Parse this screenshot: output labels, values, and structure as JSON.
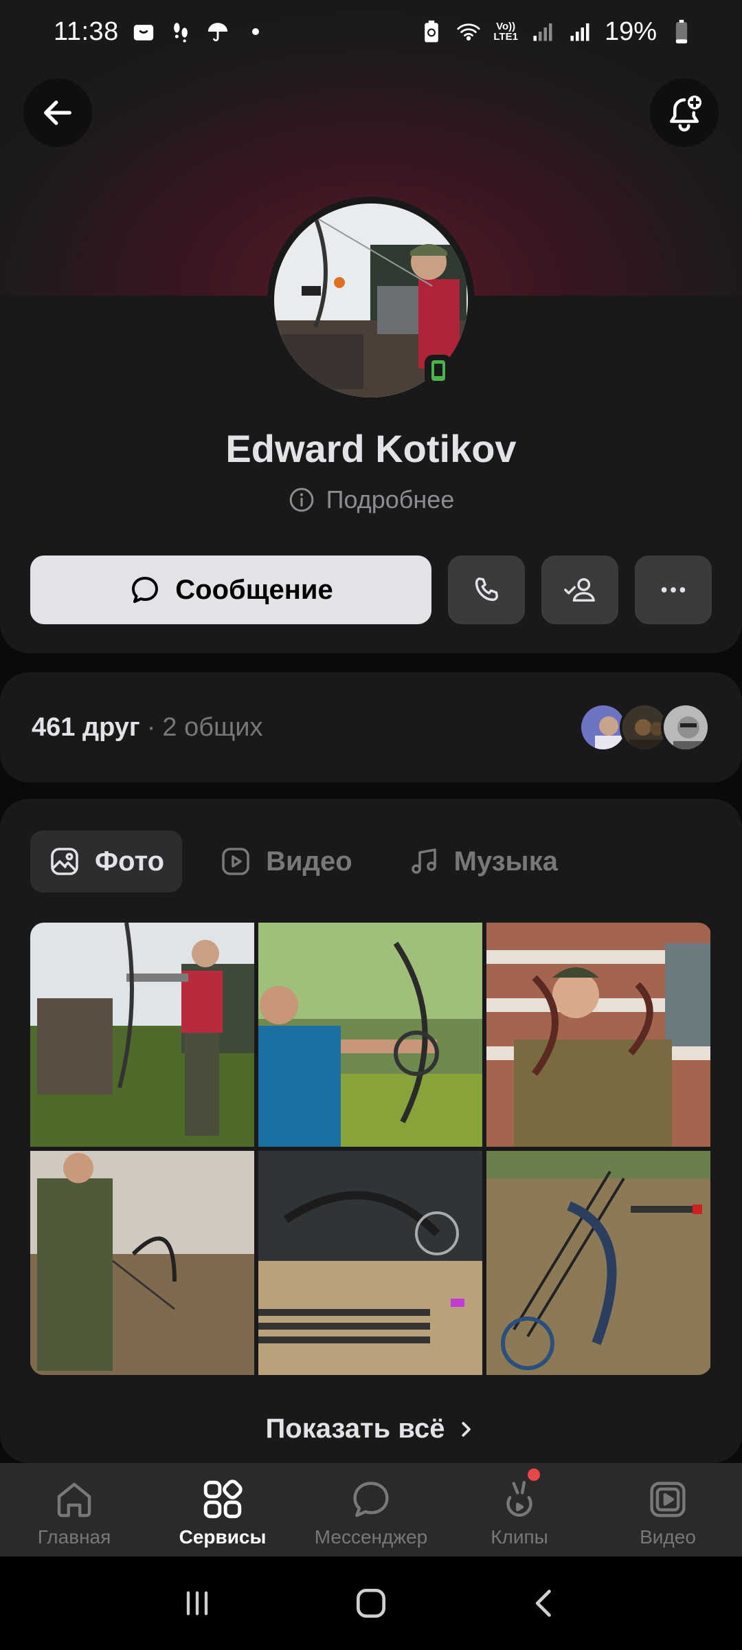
{
  "status_bar": {
    "time": "11:38",
    "lte_label_top": "Vo))",
    "lte_label_bottom": "LTE1",
    "battery_percent": "19%",
    "battery_level": 0.19
  },
  "profile": {
    "name": "Edward Kotikov",
    "details_label": "Подробнее",
    "online_status": "mobile"
  },
  "actions": {
    "message_label": "Сообщение"
  },
  "friends": {
    "count_label": "461 друг",
    "separator": "·",
    "common_label": "2 общих"
  },
  "media": {
    "tabs": [
      {
        "label": "Фото",
        "icon": "image-icon",
        "active": true
      },
      {
        "label": "Видео",
        "icon": "video-icon",
        "active": false
      },
      {
        "label": "Музыка",
        "icon": "music-icon",
        "active": false
      }
    ],
    "show_all_label": "Показать всё"
  },
  "tabbar": {
    "items": [
      {
        "label": "Главная",
        "icon": "home-icon",
        "active": false
      },
      {
        "label": "Сервисы",
        "icon": "services-icon",
        "active": true
      },
      {
        "label": "Мессенджер",
        "icon": "messenger-icon",
        "active": false
      },
      {
        "label": "Клипы",
        "icon": "clips-icon",
        "active": false,
        "badge": true
      },
      {
        "label": "Видео",
        "icon": "video-icon",
        "active": false
      }
    ]
  },
  "colors": {
    "background": "#0a0a0a",
    "card": "#191919",
    "accent_red": "#e64646",
    "online_green": "#4bb34b"
  }
}
